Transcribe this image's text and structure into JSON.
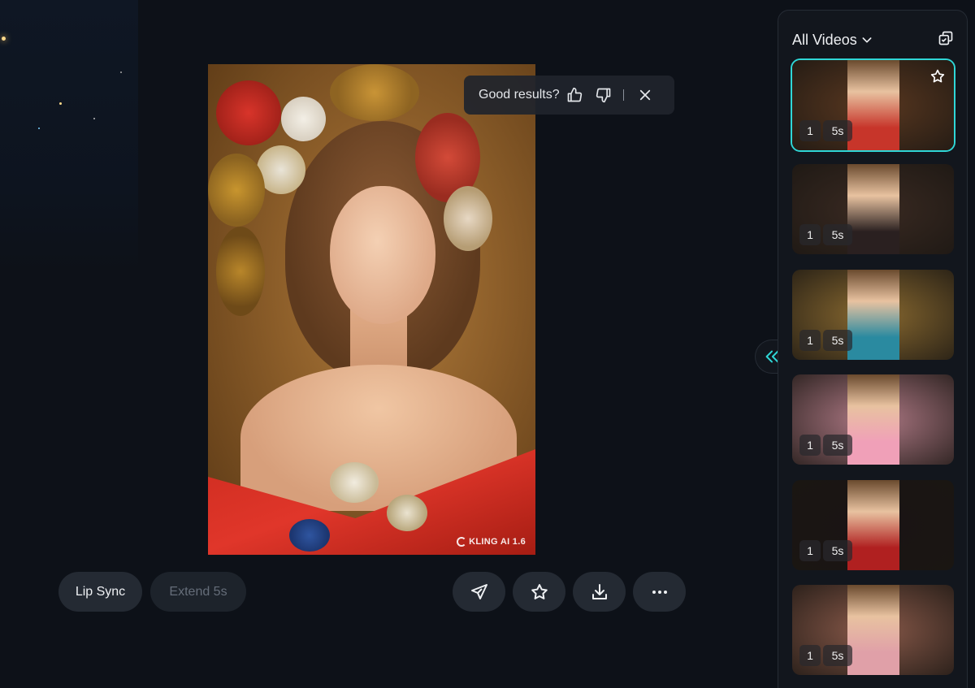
{
  "feedback": {
    "prompt": "Good results?",
    "icons": [
      "thumbs-up-icon",
      "thumbs-down-icon",
      "close-icon"
    ]
  },
  "video": {
    "watermark": "KLING AI 1.6"
  },
  "actions": {
    "lip_sync_label": "Lip Sync",
    "extend_label": "Extend 5s",
    "icons": [
      "send-icon",
      "star-icon",
      "download-icon",
      "more-icon"
    ]
  },
  "panel": {
    "title": "All Videos",
    "icons": [
      "chevron-down-icon",
      "multi-select-icon",
      "collapse-left-icon"
    ],
    "videos": [
      {
        "count": "1",
        "duration": "5s",
        "selected": true,
        "bg": "#5a3820",
        "accent": "#c7352a"
      },
      {
        "count": "1",
        "duration": "5s",
        "selected": false,
        "bg": "#3a2a22",
        "accent": "#2a2020"
      },
      {
        "count": "1",
        "duration": "5s",
        "selected": false,
        "bg": "#8a6a30",
        "accent": "#2a8aa0"
      },
      {
        "count": "1",
        "duration": "5s",
        "selected": false,
        "bg": "#b07a86",
        "accent": "#f0a0b8"
      },
      {
        "count": "1",
        "duration": "5s",
        "selected": false,
        "bg": "#1a1414",
        "accent": "#b02020"
      },
      {
        "count": "1",
        "duration": "5s",
        "selected": false,
        "bg": "#8a5a4a",
        "accent": "#e0a0a8"
      }
    ]
  },
  "colors": {
    "accent": "#2fd6d6",
    "background": "#0d1118",
    "button": "#242a33"
  }
}
